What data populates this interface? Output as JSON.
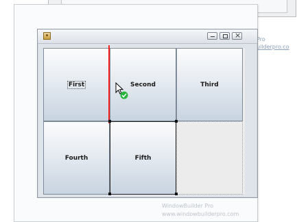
{
  "background_window": {},
  "side_text": {
    "line1": "Pro",
    "line2": "uilderpro.co"
  },
  "frame": {
    "buttons": {
      "minimize": "minimize",
      "maximize": "maximize",
      "close": "close"
    }
  },
  "grid": {
    "cells": [
      {
        "label": "First"
      },
      {
        "label": "Second"
      },
      {
        "label": "Third"
      },
      {
        "label": "Fourth"
      },
      {
        "label": "Fifth"
      }
    ]
  },
  "watermark": {
    "line1": "WindowBuilder Pro",
    "line2": "www.windowbuilderpro.com"
  },
  "colors": {
    "insert_line": "#ff2020",
    "ok_badge": "#27b53d"
  },
  "icons": [
    "app-icon",
    "minimize-icon",
    "maximize-icon",
    "close-icon",
    "cursor-arrow-icon",
    "check-badge-icon"
  ]
}
